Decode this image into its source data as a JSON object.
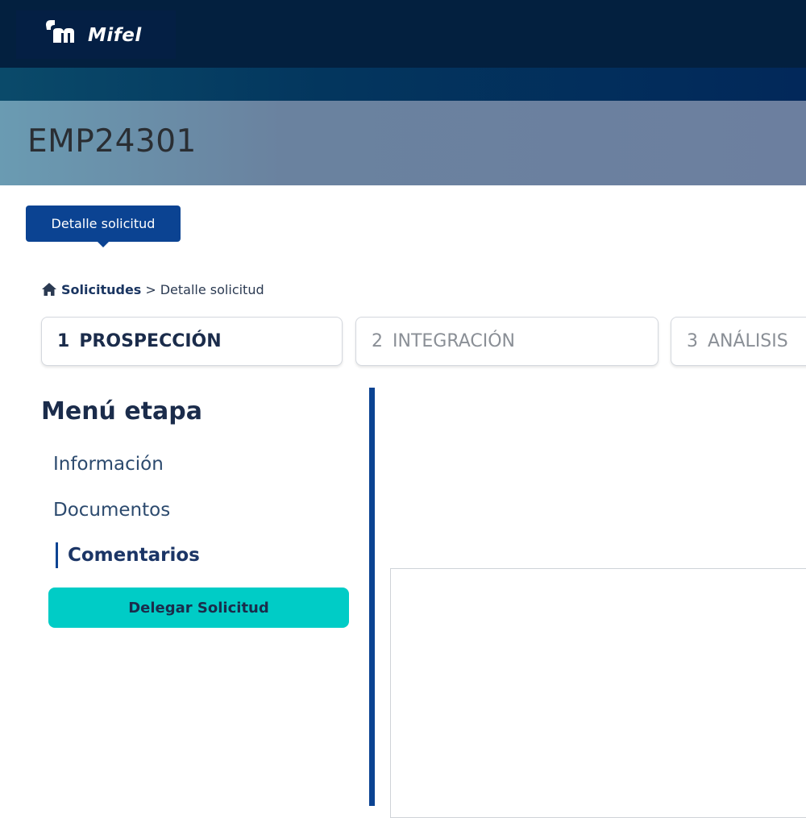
{
  "header": {
    "brand": "Mifel",
    "logo_icon": "mifel-logo-icon"
  },
  "hero": {
    "title": "EMP24301"
  },
  "tab": {
    "label": "Detalle solicitud"
  },
  "breadcrumb": {
    "home_icon": "home-icon",
    "root": "Solicitudes",
    "separator": ">",
    "current": "Detalle solicitud"
  },
  "stages": [
    {
      "number": "1",
      "label": "PROSPECCIÓN",
      "state": "active"
    },
    {
      "number": "2",
      "label": "INTEGRACIÓN",
      "state": "inactive"
    },
    {
      "number": "3",
      "label": "ANÁLISIS",
      "state": "inactive"
    }
  ],
  "menu": {
    "title": "Menú etapa",
    "items": [
      {
        "label": "Información",
        "active": false
      },
      {
        "label": "Documentos",
        "active": false
      },
      {
        "label": "Comentarios",
        "active": true
      }
    ],
    "delegate_button": "Delegar Solicitud"
  },
  "colors": {
    "topbar": "#03203f",
    "primary": "#0b4392",
    "accent": "#00ccc6",
    "text_dark": "#1b2c4b"
  }
}
